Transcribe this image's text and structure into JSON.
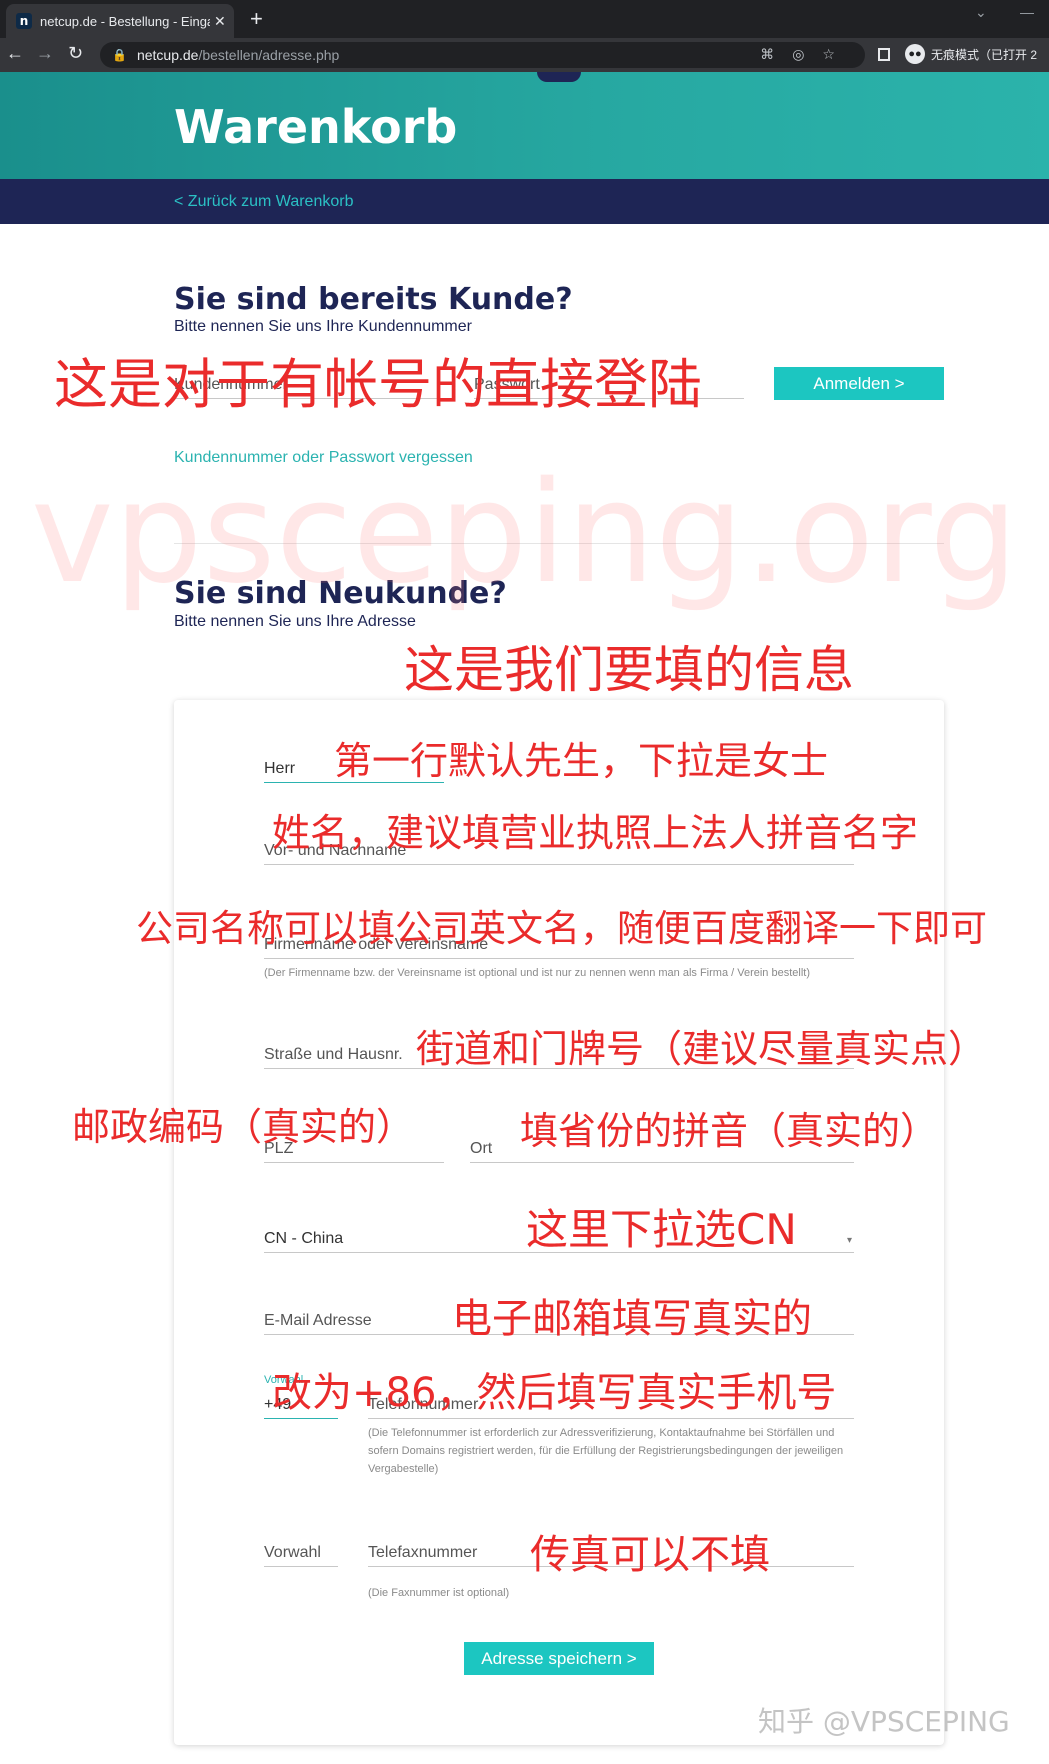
{
  "browser": {
    "tab_title": "netcup.de - Bestellung - Eingabe",
    "tab_favicon": "n",
    "url_domain": "netcup.de",
    "url_path": "/bestellen/adresse.php",
    "incognito_label": "无痕模式（已打开 2"
  },
  "header": {
    "title": "Warenkorb",
    "back_link": "< Zurück zum Warenkorb"
  },
  "login": {
    "heading": "Sie sind bereits Kunde?",
    "subheading": "Bitte nennen Sie uns Ihre Kundennummer",
    "customer_number_placeholder": "Kundennummer",
    "password_placeholder": "Passwort",
    "login_button": "Anmelden >",
    "forgot_link": "Kundennummer oder Passwort vergessen"
  },
  "signup": {
    "heading": "Sie sind Neukunde?",
    "subheading": "Bitte nennen Sie uns Ihre Adresse"
  },
  "address_form": {
    "salutation_value": "Herr",
    "name_placeholder": "Vor- und Nachname",
    "company_placeholder": "Firmenname oder Vereinsname",
    "company_hint": "(Der Firmenname bzw. der Vereinsname ist optional und ist nur zu nennen wenn man als Firma / Verein bestellt)",
    "street_placeholder": "Straße und Hausnr.",
    "zip_placeholder": "PLZ",
    "city_placeholder": "Ort",
    "country_value": "CN - China",
    "email_placeholder": "E-Mail Adresse",
    "phone_prefix_label": "Vorwahl",
    "phone_prefix_value": "+49",
    "phone_placeholder": "Telefonnummer",
    "phone_hint": "(Die Telefonnummer ist erforderlich zur Adressverifizierung, Kontaktaufnahme bei Störfällen und sofern Domains registriert werden, für die Erfüllung der Registrierungsbedingungen der jeweiligen Vergabestelle)",
    "fax_prefix_placeholder": "Vorwahl",
    "fax_placeholder": "Telefaxnummer",
    "fax_hint": "(Die Faxnummer ist optional)",
    "save_button": "Adresse speichern >"
  },
  "annotations": {
    "watermark": "vpsceping.org",
    "login_note": "这是对于有帐号的直接登陆",
    "signup_note": "这是我们要填的信息",
    "salutation_note": "第一行默认先生，下拉是女士",
    "name_note": "姓名，建议填营业执照上法人拼音名字",
    "company_note": "公司名称可以填公司英文名，随便百度翻译一下即可",
    "street_note": "街道和门牌号（建议尽量真实点）",
    "zip_note": "邮政编码（真实的）",
    "city_note": "填省份的拼音（真实的）",
    "country_note": "这里下拉选CN",
    "email_note": "电子邮箱填写真实的",
    "phone_note": "改为+86，然后填写真实手机号",
    "fax_note": "传真可以不填",
    "credit": "知乎 @VPSCEPING"
  },
  "colors": {
    "navy": "#1e2555",
    "teal": "#27a9a2",
    "button": "#1cc6c1",
    "annotation_red": "#ea2b2b"
  }
}
